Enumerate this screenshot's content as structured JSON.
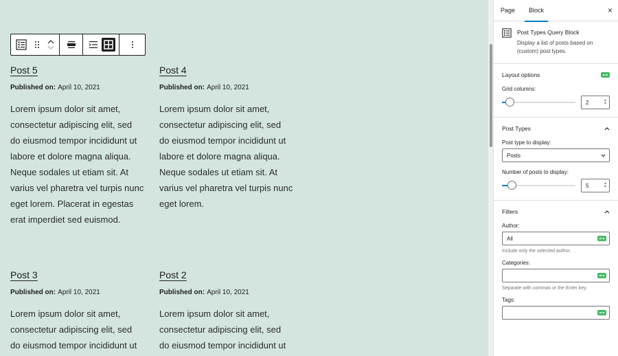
{
  "toolbar": {
    "icons": [
      "post-types-query-icon",
      "drag-handle-icon",
      "move-up-icon",
      "move-down-icon",
      "align-center-icon",
      "list-view-icon",
      "grid-view-icon",
      "more-options-icon"
    ]
  },
  "posts": [
    {
      "title": "Post 5",
      "meta_label": "Published on:",
      "date": "April 10, 2021",
      "body": "Lorem ipsum dolor sit amet, consectetur adipiscing elit, sed do eiusmod tempor incididunt ut labore et dolore magna aliqua. Neque sodales ut etiam sit. At varius vel pharetra vel turpis nunc eget lorem. Placerat in egestas erat imperdiet sed euismod."
    },
    {
      "title": "Post 4",
      "meta_label": "Published on:",
      "date": "April 10, 2021",
      "body": "Lorem ipsum dolor sit amet, consectetur adipiscing elit, sed do eiusmod tempor incididunt ut labore et dolore magna aliqua. Neque sodales ut etiam sit. At varius vel pharetra vel turpis nunc eget lorem."
    },
    {
      "title": "Post 3",
      "meta_label": "Published on:",
      "date": "April 10, 2021",
      "body": "Lorem ipsum dolor sit amet, consectetur adipiscing elit, sed do eiusmod tempor incididunt ut labore et dolore magna"
    },
    {
      "title": "Post 2",
      "meta_label": "Published on:",
      "date": "April 10, 2021",
      "body": "Lorem ipsum dolor sit amet, consectetur adipiscing elit, sed do eiusmod tempor incididunt ut labore et dolore magna"
    }
  ],
  "sidebar": {
    "tabs": [
      "Page",
      "Block"
    ],
    "active_tab": "Block",
    "close_symbol": "×",
    "block": {
      "title": "Post Types Query Block",
      "description": "Display a list of posts based on (custom) post types."
    },
    "layout": {
      "title": "Layout options",
      "grid_label": "Grid columns:",
      "grid_value": "2",
      "grid_fraction": 0.05
    },
    "post_types": {
      "title": "Post Types",
      "type_label": "Post type to display:",
      "type_value": "Posts",
      "count_label": "Number of posts to display:",
      "count_value": "5",
      "count_fraction": 0.08
    },
    "filters": {
      "title": "Filters",
      "author_label": "Author:",
      "author_value": "All",
      "author_help": "Include only the selected author.",
      "categories_label": "Categories:",
      "categories_value": "",
      "categories_help": "Separate with commas or the Enter key.",
      "tags_label": "Tags:",
      "tags_value": ""
    }
  },
  "colors": {
    "canvas_bg": "#d3e5de",
    "accent": "#007cba",
    "badge": "#4ab866"
  }
}
